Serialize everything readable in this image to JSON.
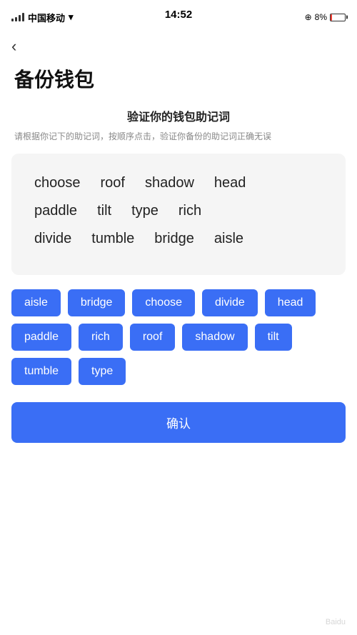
{
  "statusBar": {
    "carrier": "中国移动",
    "time": "14:52",
    "battery": "8%"
  },
  "backBtn": "‹",
  "pageTitle": "备份钱包",
  "sectionTitle": "验证你的钱包助记词",
  "sectionDesc": "请根据你记下的助记词，按顺序点击，验证你备份的助记词正确无误",
  "displayWords": [
    "choose",
    "roof",
    "shadow",
    "head",
    "paddle",
    "tilt",
    "type",
    "rich",
    "divide",
    "tumble",
    "bridge",
    "aisle"
  ],
  "wordButtons": [
    "aisle",
    "bridge",
    "choose",
    "divide",
    "head",
    "paddle",
    "rich",
    "roof",
    "shadow",
    "tilt",
    "tumble",
    "type"
  ],
  "confirmLabel": "确认"
}
